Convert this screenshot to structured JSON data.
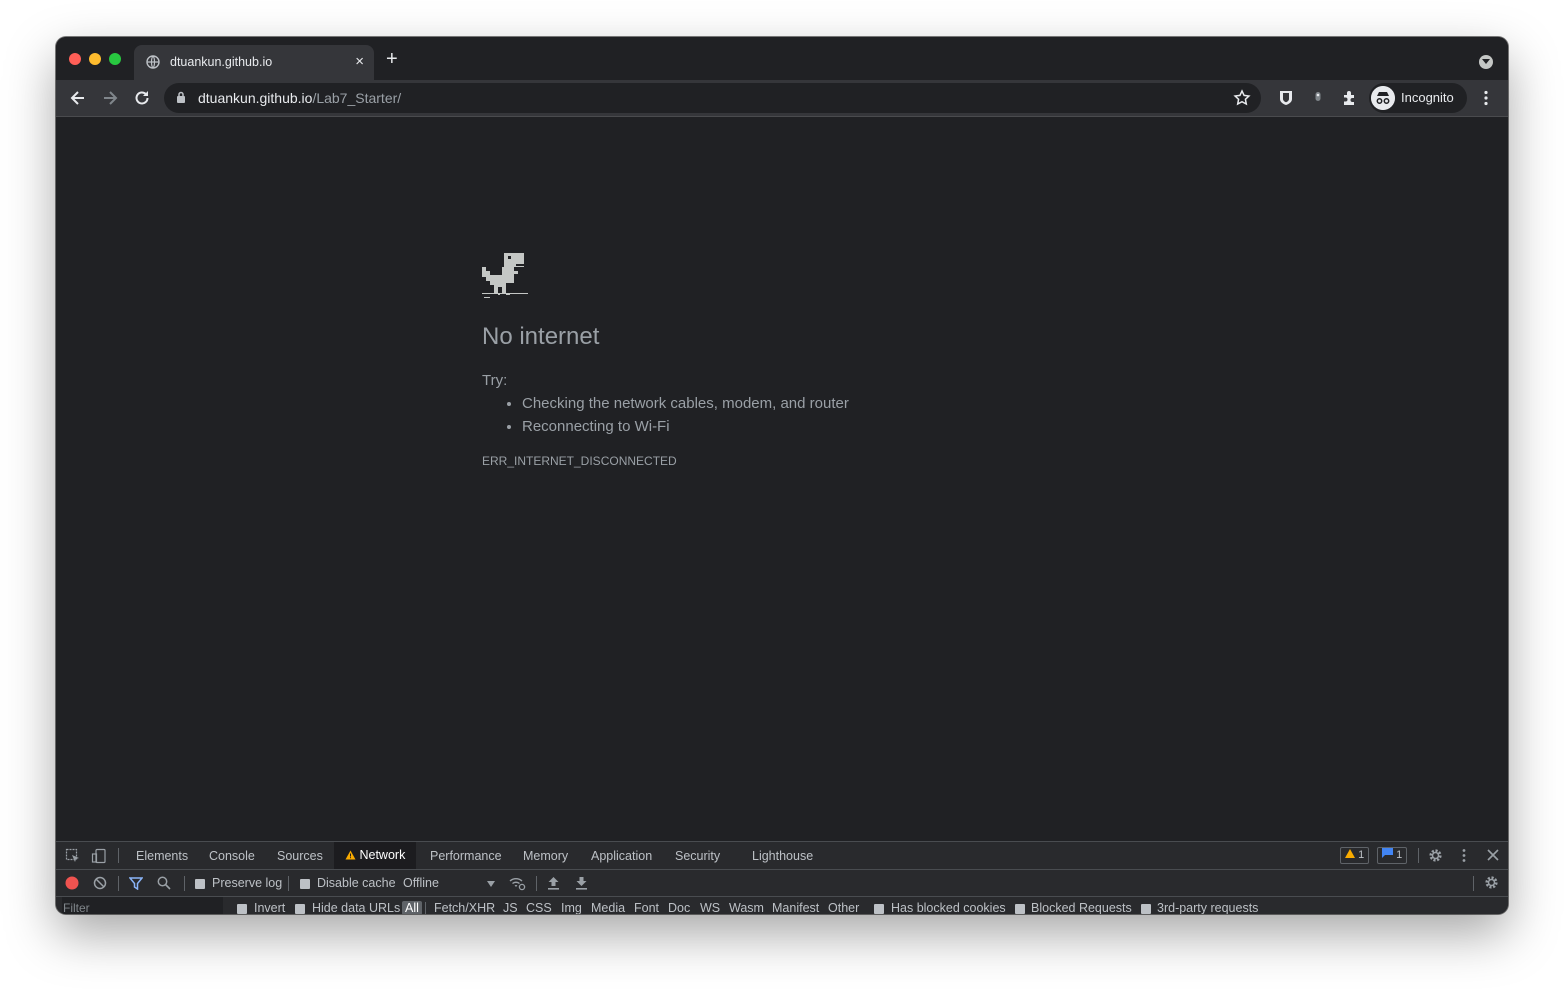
{
  "browser": {
    "tab": {
      "title": "dtuankun.github.io"
    },
    "newtab_label": "+",
    "close_tab": "×",
    "omnibox": {
      "host": "dtuankun.github.io",
      "path": "/Lab7_Starter/"
    },
    "profile": {
      "label": "Incognito"
    }
  },
  "page": {
    "heading": "No internet",
    "try_label": "Try:",
    "suggestions": [
      "Checking the network cables, modem, and router",
      "Reconnecting to Wi-Fi"
    ],
    "error_code": "ERR_INTERNET_DISCONNECTED"
  },
  "devtools": {
    "tabs": [
      "Elements",
      "Console",
      "Sources",
      "Network",
      "Performance",
      "Memory",
      "Application",
      "Security",
      "Lighthouse"
    ],
    "active_tab": "Network",
    "warning_count": "1",
    "message_count": "1",
    "toolbar": {
      "preserve_log": "Preserve log",
      "disable_cache": "Disable cache",
      "throttling": "Offline"
    },
    "filter": {
      "placeholder": "Filter",
      "invert": "Invert",
      "hide_data_urls": "Hide data URLs",
      "types": [
        "All",
        "Fetch/XHR",
        "JS",
        "CSS",
        "Img",
        "Media",
        "Font",
        "Doc",
        "WS",
        "Wasm",
        "Manifest",
        "Other"
      ],
      "has_blocked_cookies": "Has blocked cookies",
      "blocked_requests": "Blocked Requests",
      "third_party": "3rd-party requests"
    }
  },
  "colors": {
    "window_bg": "#202124",
    "toolbar_bg": "#35363a",
    "text_secondary": "#9aa0a6",
    "warning": "#f9ab00",
    "info": "#1a73e8",
    "record": "#ef5350"
  }
}
